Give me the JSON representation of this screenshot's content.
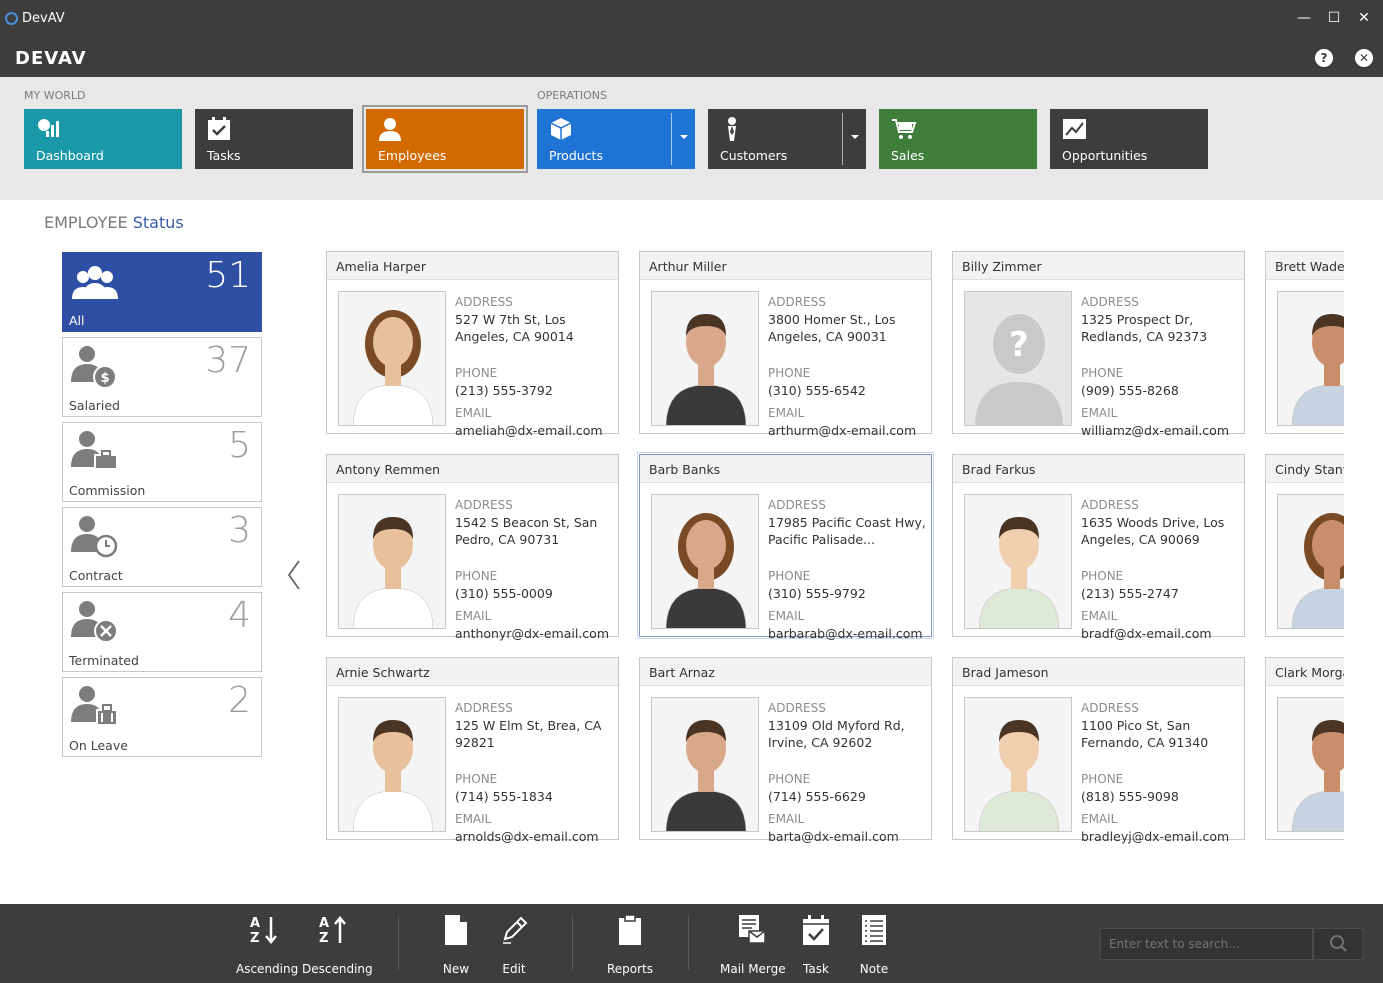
{
  "window": {
    "title": "DevAV",
    "logo_text": "DEVAV",
    "minimize": "—",
    "maximize": "☐",
    "close": "✕",
    "help": "?",
    "exit": "✕"
  },
  "ribbon": {
    "groups": [
      {
        "label": "MY WORLD"
      },
      {
        "label": "OPERATIONS"
      }
    ],
    "tiles": [
      {
        "label": "Dashboard",
        "color": "#1a98a8",
        "icon": "dashboard-icon"
      },
      {
        "label": "Tasks",
        "color": "#3d3d3d",
        "icon": "tasks-icon"
      },
      {
        "label": "Employees",
        "color": "#d26a00",
        "icon": "employee-icon",
        "selected": true
      },
      {
        "label": "Products",
        "color": "#1e73d4",
        "icon": "products-icon",
        "dropdown": true
      },
      {
        "label": "Customers",
        "color": "#3d3d3d",
        "icon": "customers-icon",
        "dropdown": true
      },
      {
        "label": "Sales",
        "color": "#3e7d3a",
        "icon": "cart-icon"
      },
      {
        "label": "Opportunities",
        "color": "#3d3d3d",
        "icon": "chart-icon"
      }
    ]
  },
  "status": {
    "title_part1": "EMPLOYEE",
    "title_part2": " Status"
  },
  "filters": [
    {
      "label": "All",
      "count": "51",
      "icon": "group-icon",
      "active": true
    },
    {
      "label": "Salaried",
      "count": "37",
      "icon": "salaried-icon"
    },
    {
      "label": "Commission",
      "count": "5",
      "icon": "commission-icon"
    },
    {
      "label": "Contract",
      "count": "3",
      "icon": "contract-icon"
    },
    {
      "label": "Terminated",
      "count": "4",
      "icon": "terminated-icon"
    },
    {
      "label": "On Leave",
      "count": "2",
      "icon": "on-leave-icon"
    }
  ],
  "labels": {
    "address": "ADDRESS",
    "phone": "PHONE",
    "email": "EMAIL"
  },
  "employees": [
    {
      "name": "Amelia Harper",
      "address": "527 W 7th St, Los Angeles, CA 90014",
      "phone": "(213) 555-3792",
      "email": "ameliah@dx-email.com",
      "photo": "female-photo"
    },
    {
      "name": "Arthur Miller",
      "address": "3800 Homer St., Los Angeles, CA 90031",
      "phone": "(310) 555-6542",
      "email": "arthurm@dx-email.com",
      "photo": "male-photo"
    },
    {
      "name": "Billy Zimmer",
      "address": "1325 Prospect Dr, Redlands, CA 92373",
      "phone": "(909) 555-8268",
      "email": "williamz@dx-email.com",
      "photo": "unknown-photo"
    },
    {
      "name": "Brett Wade",
      "address": "",
      "phone": "",
      "email": "",
      "photo": "male-photo"
    },
    {
      "name": "Antony Remmen",
      "address": "1542 S Beacon St, San Pedro, CA 90731",
      "phone": "(310) 555-0009",
      "email": "anthonyr@dx-email.com",
      "photo": "male-photo"
    },
    {
      "name": "Barb Banks",
      "address": "17985 Pacific Coast Hwy, Pacific Palisade...",
      "phone": "(310) 555-9792",
      "email": "barbarab@dx-email.com",
      "photo": "female-photo",
      "selected": true
    },
    {
      "name": "Brad Farkus",
      "address": "1635 Woods Drive, Los Angeles, CA 90069",
      "phone": "(213) 555-2747",
      "email": "bradf@dx-email.com",
      "photo": "male-photo"
    },
    {
      "name": "Cindy Stanwick",
      "address": "",
      "phone": "",
      "email": "",
      "photo": "female-photo"
    },
    {
      "name": "Arnie Schwartz",
      "address": "125 W Elm St, Brea, CA 92821",
      "phone": "(714) 555-1834",
      "email": "arnolds@dx-email.com",
      "photo": "male-photo"
    },
    {
      "name": "Bart Arnaz",
      "address": "13109 Old Myford Rd, Irvine, CA 92602",
      "phone": "(714) 555-6629",
      "email": "barta@dx-email.com",
      "photo": "male-photo"
    },
    {
      "name": "Brad Jameson",
      "address": "1100 Pico St, San Fernando, CA 91340",
      "phone": "(818) 555-9098",
      "email": "bradleyj@dx-email.com",
      "photo": "male-photo"
    },
    {
      "name": "Clark Morgan",
      "address": "",
      "phone": "",
      "email": "",
      "photo": "male-photo"
    }
  ],
  "toolbar": {
    "buttons": [
      {
        "label": "Ascending",
        "icon": "sort-ascending-icon"
      },
      {
        "label": "Descending",
        "icon": "sort-descending-icon"
      },
      {
        "label": "New",
        "icon": "new-document-icon"
      },
      {
        "label": "Edit",
        "icon": "edit-icon"
      },
      {
        "label": "Reports",
        "icon": "reports-icon"
      },
      {
        "label": "Mail Merge",
        "icon": "mail-merge-icon"
      },
      {
        "label": "Task",
        "icon": "task-icon"
      },
      {
        "label": "Note",
        "icon": "note-icon"
      }
    ],
    "search_placeholder": "Enter text to search..."
  }
}
